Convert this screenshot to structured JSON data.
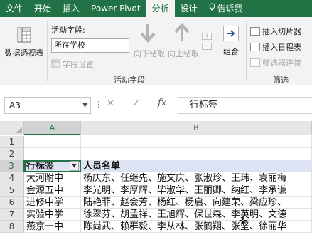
{
  "ribbon_tabs": [
    {
      "label": "文件",
      "active": false
    },
    {
      "label": "开始",
      "active": false
    },
    {
      "label": "插入",
      "active": false
    },
    {
      "label": "Power Pivot",
      "active": false
    },
    {
      "label": "分析",
      "active": true
    },
    {
      "label": "设计",
      "active": false
    },
    {
      "label": "告诉我",
      "active": false
    }
  ],
  "ribbon": {
    "pivot_table_label": "数据透视表",
    "active_field_label": "活动字段:",
    "active_field_value": "所在学校",
    "field_settings_label": "字段设置",
    "drill_down_label": "向下钻取",
    "drill_up_label": "向上钻取",
    "active_field_group_label": "活动字段",
    "group_label": "组合",
    "insert_slicer_label": "插入切片器",
    "insert_timeline_label": "插入日程表",
    "filter_connections_label": "筛选器连接",
    "filter_group_label": "筛选"
  },
  "formula_bar": {
    "name_box": "A3",
    "fx": "fx",
    "content": "行标签"
  },
  "grid": {
    "columns": [
      "A",
      "B"
    ],
    "selected_column": "A",
    "rows": [
      "1",
      "2",
      "3",
      "4",
      "5",
      "6",
      "7",
      "8"
    ],
    "selected_row": "3",
    "header_a": "行标签",
    "header_b": "人员名单",
    "data_rows": [
      {
        "school": "大河附中",
        "names": "杨庆东、任继先、施文庆、张淑珍、王玮、袁丽梅"
      },
      {
        "school": "金源五中",
        "names": "李光明、李厚辉、毕淑华、王丽卿、纳红、李承谦"
      },
      {
        "school": "进修中学",
        "names": "陆艳菲、赵会芳、杨红、杨启、向建荣、梁应珍、"
      },
      {
        "school": "实验中学",
        "names": "徐翠芬、胡孟祥、王旭辉、保世森、李英明、文德"
      },
      {
        "school": "燕京一中",
        "names": "陈尚武、赖群毅、李从林、张鹤翔、张坚、徐丽华"
      }
    ]
  },
  "colors": {
    "brand": "#217346",
    "ribbon_bg": "#f3f3f3",
    "pivot_header_bg": "#dde3f2"
  }
}
